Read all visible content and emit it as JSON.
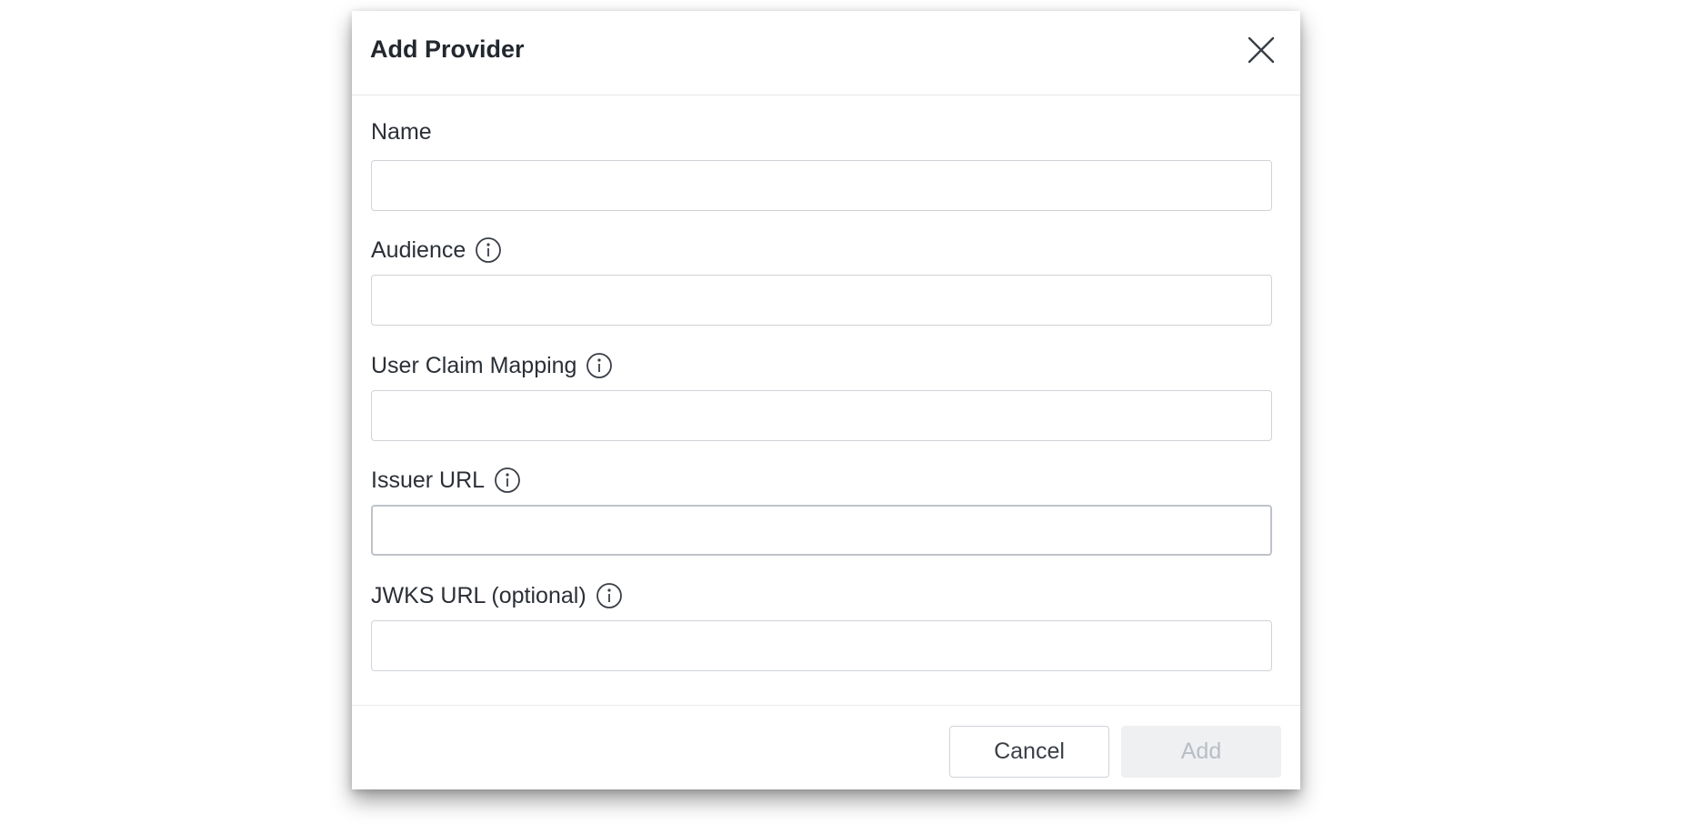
{
  "dialog": {
    "title": "Add Provider",
    "close_icon": "close-icon",
    "fields": [
      {
        "label": "Name",
        "value": "",
        "has_info": false
      },
      {
        "label": "Audience",
        "value": "",
        "has_info": true
      },
      {
        "label": "User Claim Mapping",
        "value": "",
        "has_info": true
      },
      {
        "label": "Issuer URL",
        "value": "",
        "has_info": true
      },
      {
        "label": "JWKS URL (optional)",
        "value": "",
        "has_info": true
      }
    ],
    "info_icon": "info-icon",
    "footer": {
      "cancel_label": "Cancel",
      "add_label": "Add",
      "add_disabled": true
    }
  },
  "colors": {
    "text": "#2b2f36",
    "border": "#cfd3d8",
    "disabled_bg": "#eef0f2",
    "disabled_text": "#b9bec5"
  }
}
